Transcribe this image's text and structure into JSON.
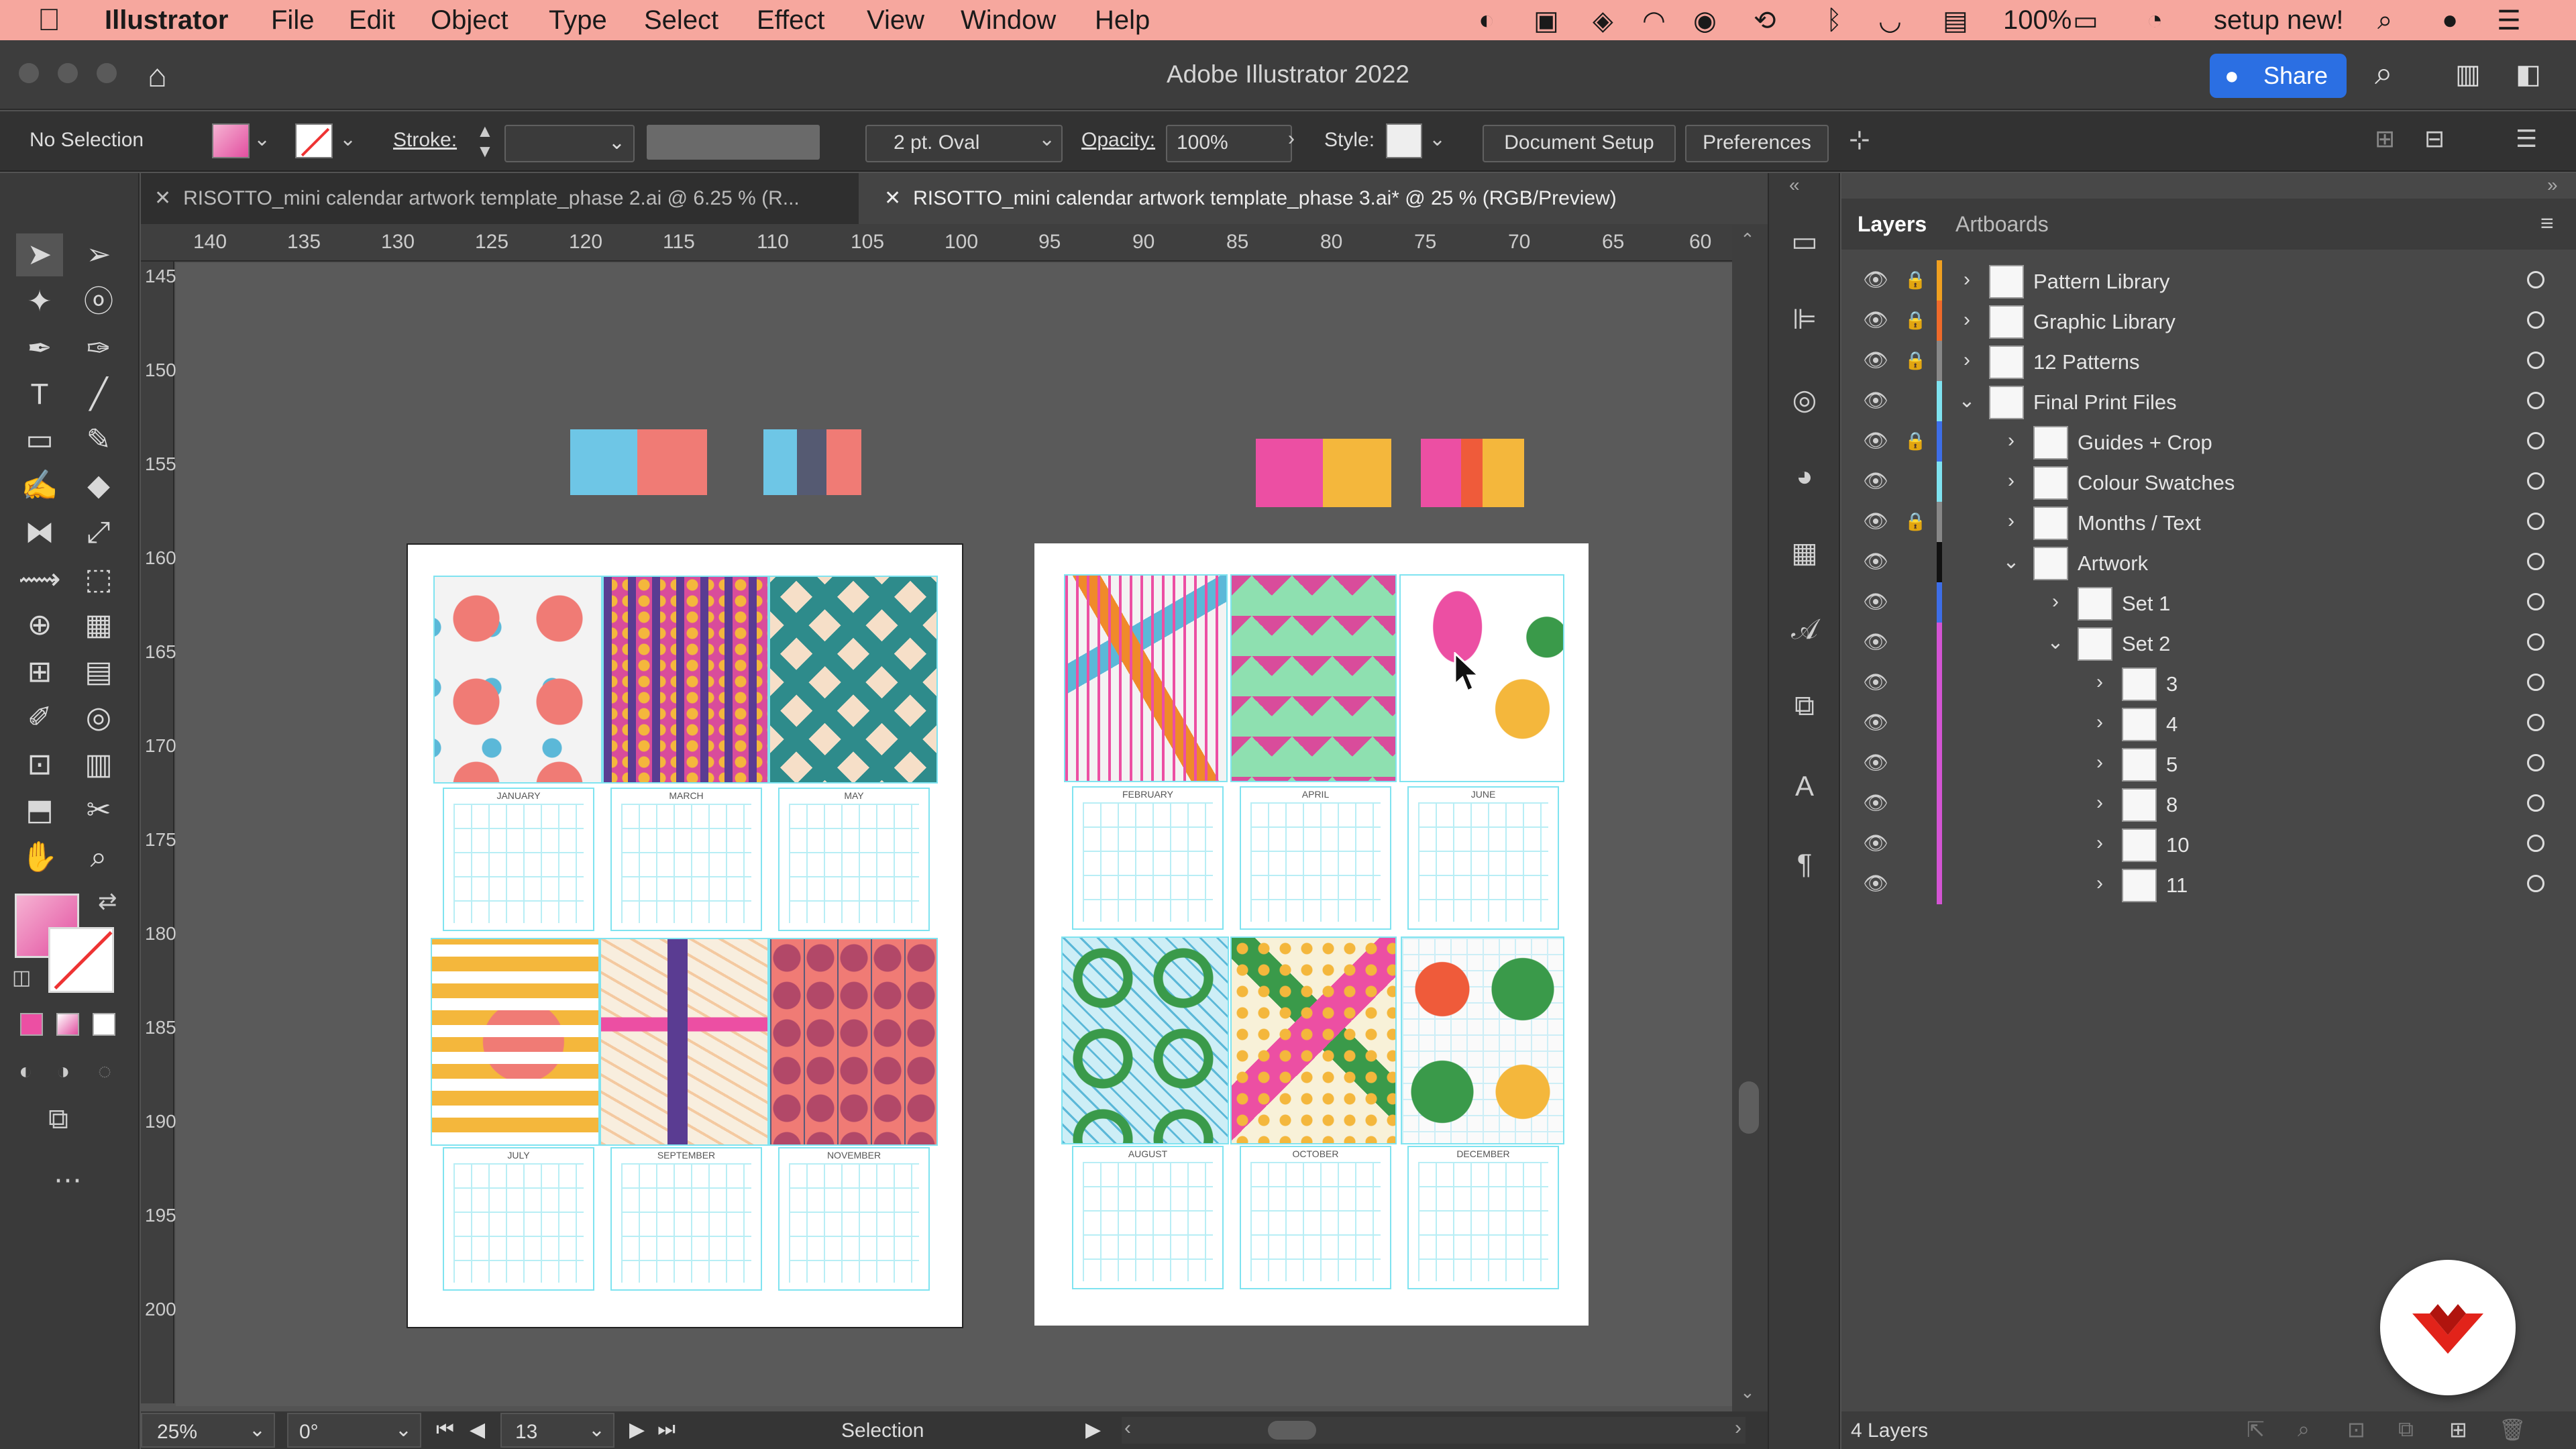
{
  "menubar": {
    "app": "Illustrator",
    "menus": [
      "File",
      "Edit",
      "Object",
      "Type",
      "Select",
      "Effect",
      "View",
      "Window",
      "Help"
    ],
    "battery": "100%",
    "right_text": "setup new!"
  },
  "titlebar": {
    "title": "Adobe Illustrator 2022",
    "share": "Share"
  },
  "controlbar": {
    "selection": "No Selection",
    "stroke_label": "Stroke:",
    "brush": "2 pt. Oval",
    "opacity_label": "Opacity:",
    "opacity": "100%",
    "style_label": "Style:",
    "document_setup": "Document Setup",
    "preferences": "Preferences"
  },
  "tabs": [
    {
      "label": "RISOTTO_mini calendar artwork template_phase 2.ai @ 6.25 % (R..."
    },
    {
      "label": "RISOTTO_mini calendar artwork template_phase 3.ai* @ 25 % (RGB/Preview)"
    }
  ],
  "ruler": {
    "h": [
      "140",
      "135",
      "130",
      "125",
      "120",
      "115",
      "110",
      "105",
      "100",
      "95",
      "90",
      "85",
      "80",
      "75",
      "70",
      "65",
      "60"
    ],
    "v": [
      "145",
      "150",
      "155",
      "160",
      "165",
      "170",
      "175",
      "180",
      "185",
      "190",
      "195",
      "200"
    ]
  },
  "status": {
    "zoom": "25%",
    "rotation": "0°",
    "artboard": "13",
    "tool": "Selection"
  },
  "layers_panel": {
    "tabs": [
      "Layers",
      "Artboards"
    ],
    "footer": "4 Layers",
    "rows": [
      {
        "name": "Pattern Library",
        "color": "#f0a020"
      },
      {
        "name": "Graphic Library",
        "color": "#ef6a2a"
      },
      {
        "name": "12 Patterns",
        "color": "#888888"
      },
      {
        "name": "Final Print Files",
        "color": "#7fe3f0"
      },
      {
        "name": "Guides + Crop",
        "color": "#3d6ee8"
      },
      {
        "name": "Colour Swatches",
        "color": "#7fe3f0"
      },
      {
        "name": "Months / Text",
        "color": "#888888"
      },
      {
        "name": "Artwork",
        "color": "#111111"
      },
      {
        "name": "Set 1",
        "color": "#3d6ee8"
      },
      {
        "name": "Set 2",
        "color": "#d454d4"
      },
      {
        "name": "3",
        "color": "#d454d4"
      },
      {
        "name": "4",
        "color": "#d454d4"
      },
      {
        "name": "5",
        "color": "#d454d4"
      },
      {
        "name": "8",
        "color": "#d454d4"
      },
      {
        "name": "10",
        "color": "#d454d4"
      },
      {
        "name": "11",
        "color": "#d454d4"
      }
    ]
  },
  "artwork": {
    "set1_months": [
      "JANUARY",
      "MARCH",
      "MAY",
      "JULY",
      "SEPTEMBER",
      "NOVEMBER"
    ],
    "set2_months": [
      "FEBRUARY",
      "APRIL",
      "JUNE",
      "AUGUST",
      "OCTOBER",
      "DECEMBER"
    ]
  },
  "colors": {
    "menubar": "#f6a79e",
    "accent": "#2b6fe3",
    "blue": "#6ec6e6",
    "coral": "#f07b75",
    "pink": "#ec4fa3",
    "yellow": "#f4b73c",
    "green": "#3a9a4a"
  }
}
